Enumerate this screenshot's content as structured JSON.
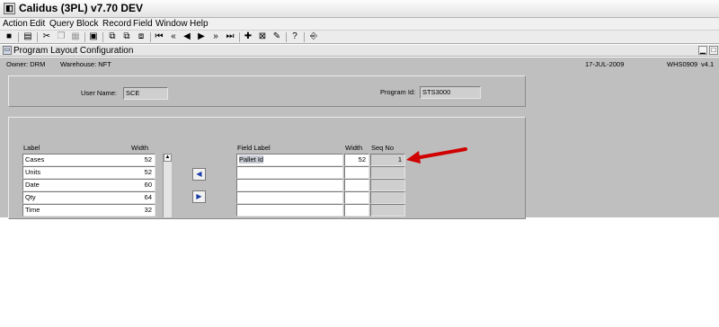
{
  "window": {
    "title": "Calidus (3PL) v7.70 DEV"
  },
  "menu": [
    "Action",
    "Edit",
    "Query",
    "Block",
    "Record",
    "Field",
    "Window",
    "Help"
  ],
  "toolbar": {
    "help_glyph": "?"
  },
  "subwindow": {
    "title": "Program Layout Configuration"
  },
  "info": {
    "owner": "Owner:  DRM",
    "warehouse": "Warehouse:  NFT",
    "date": "17-JUL-2009",
    "code": "WHS0909",
    "version": "v4.1"
  },
  "form": {
    "user_label": "User Name:",
    "user_value": "SCE",
    "program_label": "Program Id:",
    "program_value": "STS3000"
  },
  "available": {
    "headers": {
      "label": "Label",
      "width": "Width"
    },
    "rows": [
      {
        "label": "Cases",
        "width": "52"
      },
      {
        "label": "Units",
        "width": "52"
      },
      {
        "label": "Date",
        "width": "60"
      },
      {
        "label": "Qty",
        "width": "64"
      },
      {
        "label": "Time",
        "width": "32"
      }
    ]
  },
  "selected": {
    "headers": {
      "label": "Field Label",
      "width": "Width",
      "seq": "Seq No"
    },
    "rows": [
      {
        "label": "Pallet Id",
        "width": "52",
        "seq": "1"
      },
      {
        "label": "",
        "width": "",
        "seq": ""
      },
      {
        "label": "",
        "width": "",
        "seq": ""
      },
      {
        "label": "",
        "width": "",
        "seq": ""
      },
      {
        "label": "",
        "width": "",
        "seq": ""
      }
    ]
  },
  "colors": {
    "arrow": "#d10000",
    "nav_arrow": "#1a3da8",
    "canvas": "#bfbfbf"
  }
}
